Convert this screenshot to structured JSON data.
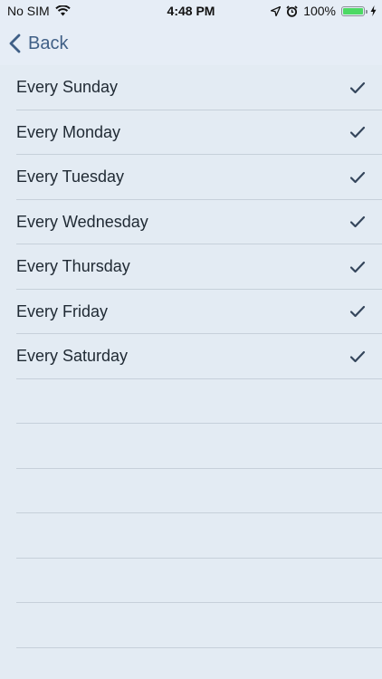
{
  "status_bar": {
    "carrier": "No SIM",
    "time": "4:48 PM",
    "battery_text": "100%",
    "icons": [
      "wifi-icon",
      "location-arrow-icon",
      "alarm-icon",
      "battery-icon",
      "charging-icon"
    ]
  },
  "nav": {
    "back_label": "Back"
  },
  "repeat_options": [
    {
      "label": "Every Sunday",
      "checked": true
    },
    {
      "label": "Every Monday",
      "checked": true
    },
    {
      "label": "Every Tuesday",
      "checked": true
    },
    {
      "label": "Every Wednesday",
      "checked": true
    },
    {
      "label": "Every Thursday",
      "checked": true
    },
    {
      "label": "Every Friday",
      "checked": true
    },
    {
      "label": "Every Saturday",
      "checked": true
    }
  ],
  "colors": {
    "accent": "#3f5f86",
    "check": "#34455b",
    "background": "#e3ebf3",
    "separator": "#c6d0da",
    "battery_fill": "#4cd964"
  }
}
